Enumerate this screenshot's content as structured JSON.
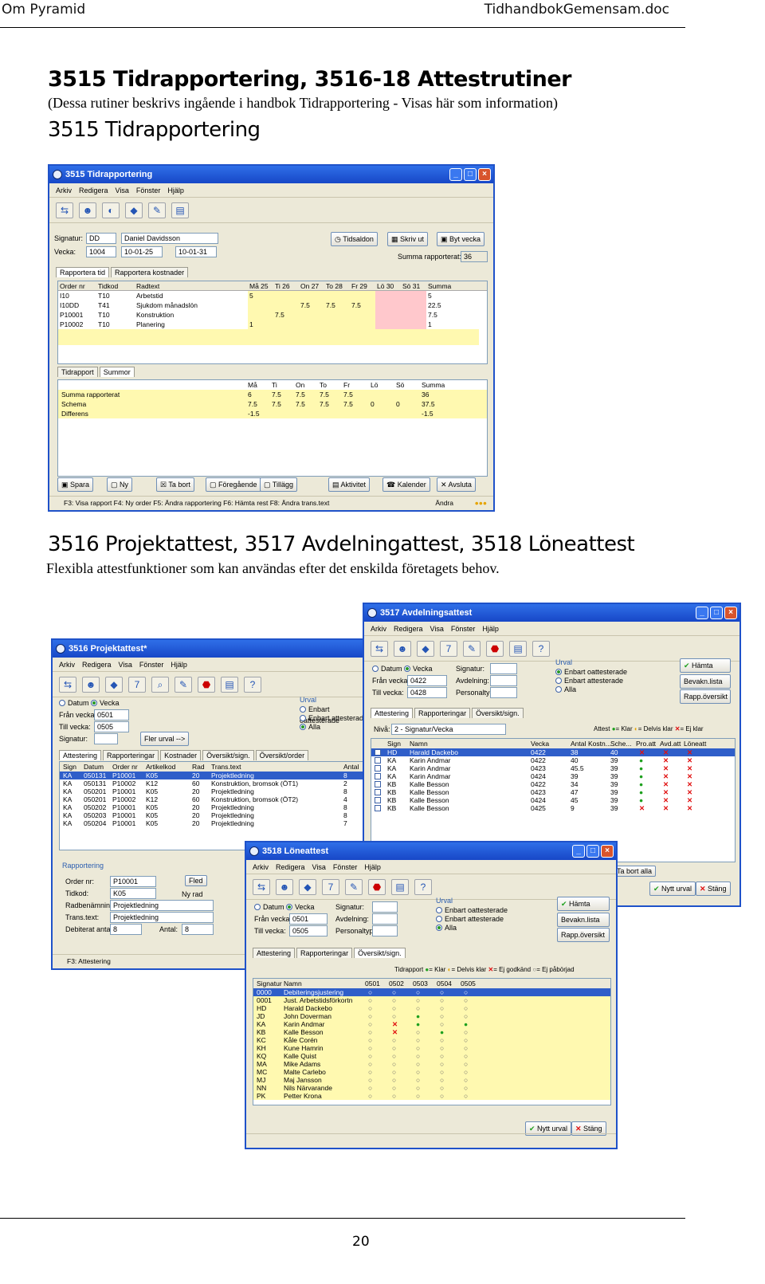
{
  "header": {
    "left": "Om Pyramid",
    "right": "TidhandbokGemensam.doc"
  },
  "title": "3515 Tidrapportering, 3516-18 Attestrutiner",
  "intro": "(Dessa rutiner beskrivs ingående i handbok Tidrapportering - Visas här som information)",
  "section1": "3515 Tidrapportering",
  "section2": "3516 Projektattest, 3517 Avdelningattest, 3518 Löneattest",
  "section2_text": "Flexibla attestfunktioner som kan användas efter det enskilda  företagets behov.",
  "page_number": "20",
  "menu": [
    "Arkiv",
    "Redigera",
    "Visa",
    "Fönster",
    "Hjälp"
  ],
  "w1": {
    "title": "3515 Tidrapportering",
    "signatur_label": "Signatur:",
    "signatur": "DD",
    "name": "Daniel Davidsson",
    "vecka_label": "Vecka:",
    "vecka": "1004",
    "from": "10-01-25",
    "to": "10-01-31",
    "btn_tidsaldon": "Tidsaldon",
    "btn_skriv": "Skriv ut",
    "btn_byt": "Byt vecka",
    "summa_label": "Summa rapporterat:",
    "summa": "36",
    "tabs": [
      "Rapportera tid",
      "Rapportera kostnader"
    ],
    "cols": [
      "Order nr",
      "Tidkod",
      "Radtext",
      "Må 25",
      "Ti 26",
      "On 27",
      "To 28",
      "Fr 29",
      "Lö 30",
      "Sö 31",
      "Summa"
    ],
    "rows": [
      [
        "I10",
        "T10",
        "Arbetstid",
        "5",
        "",
        "",
        "",
        "",
        "",
        "",
        "5"
      ],
      [
        "I10DD",
        "T41",
        "Sjukdom månadslön",
        "",
        "",
        "7.5",
        "7.5",
        "7.5",
        "",
        "",
        "22.5"
      ],
      [
        "P10001",
        "T10",
        "Konstruktion",
        "",
        "7.5",
        "",
        "",
        "",
        "",
        "",
        "7.5"
      ],
      [
        "P10002",
        "T10",
        "Planering",
        "1",
        "",
        "",
        "",
        "",
        "",
        "",
        "1"
      ]
    ],
    "tabs2": [
      "Tidrapport",
      "Summor"
    ],
    "scols": [
      "Må",
      "Ti",
      "On",
      "To",
      "Fr",
      "Lö",
      "Sö",
      "Summa"
    ],
    "srows": [
      [
        "Summa rapporterat",
        "6",
        "7.5",
        "7.5",
        "7.5",
        "7.5",
        "",
        "",
        "36"
      ],
      [
        "Schema",
        "7.5",
        "7.5",
        "7.5",
        "7.5",
        "7.5",
        "0",
        "0",
        "37.5"
      ],
      [
        "Differens",
        "-1.5",
        "",
        "",
        "",
        "",
        "",
        "",
        "-1.5"
      ]
    ],
    "btns": [
      "Spara",
      "Ny",
      "Ta bort",
      "Föregående",
      "Tillägg",
      "Aktivitet",
      "Kalender",
      "Avsluta"
    ],
    "status": "F3: Visa rapport  F4: Ny order  F5: Ändra rapportering  F6: Hämta rest  F8: Ändra trans.text",
    "status_right": "Ändra"
  },
  "w2": {
    "title": "3516 Projektattest*",
    "datum": "Datum",
    "vecka": "Vecka",
    "fran_label": "Från vecka:",
    "fran": "0501",
    "till_label": "Till vecka:",
    "till": "0505",
    "sign_label": "Signatur:",
    "fler": "Fler urval -->",
    "urval": "Urval",
    "u1": "Enbart oattesterade",
    "u2": "Enbart attesterade",
    "u3": "Alla",
    "tabs": [
      "Attestering",
      "Rapporteringar",
      "Kostnader",
      "Översikt/sign.",
      "Översikt/order"
    ],
    "cols": [
      "Sign",
      "Datum",
      "Order nr",
      "Artikelkod",
      "Rad",
      "Trans.text",
      "Antal"
    ],
    "rows": [
      [
        "KA",
        "050131",
        "P10001",
        "K05",
        "20",
        "Projektledning",
        "8"
      ],
      [
        "KA",
        "050131",
        "P10002",
        "K12",
        "60",
        "Konstruktion, bromsok (ÖT1)",
        "2"
      ],
      [
        "KA",
        "050201",
        "P10001",
        "K05",
        "20",
        "Projektledning",
        "8"
      ],
      [
        "KA",
        "050201",
        "P10002",
        "K12",
        "60",
        "Konstruktion, bromsok (ÖT2)",
        "4"
      ],
      [
        "KA",
        "050202",
        "P10001",
        "K05",
        "20",
        "Projektledning",
        "8"
      ],
      [
        "KA",
        "050203",
        "P10001",
        "K05",
        "20",
        "Projektledning",
        "8"
      ],
      [
        "KA",
        "050204",
        "P10001",
        "K05",
        "20",
        "Projektledning",
        "7"
      ]
    ],
    "rapp": "Rapportering",
    "order_label": "Order nr:",
    "order": "P10001",
    "ftl": "Fled",
    "tidkod_label": "Tidkod:",
    "tidkod": "K05",
    "nyrad": "Ny rad",
    "radben_label": "Radbenämning:",
    "radben": "Projektledning",
    "trans_label": "Trans.text:",
    "trans": "Projektledning",
    "deb_label": "Debiterat antal:",
    "deb": "8",
    "antal_label": "Antal:",
    "antal": "8",
    "status": "F3: Attestering"
  },
  "w3": {
    "title": "3517 Avdelningsattest",
    "datum": "Datum",
    "vecka": "Vecka",
    "fran_label": "Från vecka:",
    "fran": "0422",
    "till_label": "Till vecka:",
    "till": "0428",
    "sign_label": "Signatur:",
    "avd_label": "Avdelning:",
    "pers_label": "Personaltyp:",
    "urval": "Urval",
    "u1": "Enbart oattesterade",
    "u2": "Enbart attesterade",
    "u3": "Alla",
    "hamta": "Hämta",
    "bevakn": "Bevakn.lista",
    "rapp": "Rapp.översikt",
    "tabs": [
      "Attestering",
      "Rapporteringar",
      "Översikt/sign."
    ],
    "niva_label": "Nivå:",
    "niva": "2 - Signatur/Vecka",
    "legend": [
      "Attest",
      "= Klar",
      "= Delvis klar",
      "= Ej klar"
    ],
    "cols": [
      "Sign",
      "Namn",
      "Vecka",
      "Antal",
      "Kostn...",
      "Sche...",
      "Pro.att",
      "Avd.att",
      "Löneatt"
    ],
    "rows": [
      [
        "HD",
        "Harald Dackebo",
        "0422",
        "38",
        "",
        "40",
        "x",
        "x",
        "x"
      ],
      [
        "KA",
        "Karin Andmar",
        "0422",
        "40",
        "",
        "39",
        "g",
        "x",
        "x"
      ],
      [
        "KA",
        "Karin Andmar",
        "0423",
        "45.5",
        "",
        "39",
        "g",
        "x",
        "x"
      ],
      [
        "KA",
        "Karin Andmar",
        "0424",
        "39",
        "",
        "39",
        "g",
        "x",
        "x"
      ],
      [
        "KB",
        "Kalle Besson",
        "0422",
        "34",
        "",
        "39",
        "g",
        "x",
        "x"
      ],
      [
        "KB",
        "Kalle Besson",
        "0423",
        "47",
        "",
        "39",
        "g",
        "x",
        "x"
      ],
      [
        "KB",
        "Kalle Besson",
        "0424",
        "45",
        "",
        "39",
        "g",
        "x",
        "x"
      ],
      [
        "KB",
        "Kalle Besson",
        "0425",
        "9",
        "",
        "39",
        "x",
        "x",
        "x"
      ]
    ],
    "taalla": "Ta bort alla",
    "nytt": "Nytt urval",
    "stang": "Stäng"
  },
  "w4": {
    "title": "3518 Löneattest",
    "datum": "Datum",
    "vecka": "Vecka",
    "fran_label": "Från vecka:",
    "fran": "0501",
    "till_label": "Till vecka:",
    "till": "0505",
    "sign_label": "Signatur:",
    "avd_label": "Avdelning:",
    "pers_label": "Personaltyp:",
    "urval": "Urval",
    "u1": "Enbart oattesterade",
    "u2": "Enbart attesterade",
    "u3": "Alla",
    "hamta": "Hämta",
    "bevakn": "Bevakn.lista",
    "rapp": "Rapp.översikt",
    "tabs": [
      "Attestering",
      "Rapporteringar",
      "Översikt/sign."
    ],
    "legend": [
      "Tidrapport",
      "= Klar",
      "= Delvis klar",
      "= Ej godkänd",
      "= Ej påbörjad"
    ],
    "cols": [
      "Signatur",
      "Namn",
      "0501",
      "0502",
      "0503",
      "0504",
      "0505"
    ],
    "rows": [
      [
        "0000",
        "Debiteringsjustering",
        "o",
        "o",
        "o",
        "o",
        "o"
      ],
      [
        "0001",
        "Just. Arbetstidsförkortn",
        "o",
        "o",
        "o",
        "o",
        "o"
      ],
      [
        "HD",
        "Harald Dackebo",
        "o",
        "o",
        "o",
        "o",
        "o"
      ],
      [
        "JD",
        "John Doverman",
        "o",
        "o",
        "g",
        "o",
        "o"
      ],
      [
        "KA",
        "Karin Andmar",
        "o",
        "x",
        "g",
        "o",
        "g"
      ],
      [
        "KB",
        "Kalle Besson",
        "o",
        "x",
        "o",
        "g",
        "o"
      ],
      [
        "KC",
        "Kåle Corén",
        "o",
        "o",
        "o",
        "o",
        "o"
      ],
      [
        "KH",
        "Kune Hamrin",
        "o",
        "o",
        "o",
        "o",
        "o"
      ],
      [
        "KQ",
        "Kalle Quist",
        "o",
        "o",
        "o",
        "o",
        "o"
      ],
      [
        "MA",
        "Mike Adams",
        "o",
        "o",
        "o",
        "o",
        "o"
      ],
      [
        "MC",
        "Malte Carlebo",
        "o",
        "o",
        "o",
        "o",
        "o"
      ],
      [
        "MJ",
        "Maj Jansson",
        "o",
        "o",
        "o",
        "o",
        "o"
      ],
      [
        "NN",
        "Nils Närvarande",
        "o",
        "o",
        "o",
        "o",
        "o"
      ],
      [
        "PK",
        "Petter Krona",
        "o",
        "o",
        "o",
        "o",
        "o"
      ]
    ],
    "nytt": "Nytt urval",
    "stang": "Stäng"
  },
  "colors": {
    "titlebar": "#1f52c9",
    "yellow": "#fff9b0",
    "pink": "#ffc8cc",
    "select": "#2f5ec9"
  }
}
